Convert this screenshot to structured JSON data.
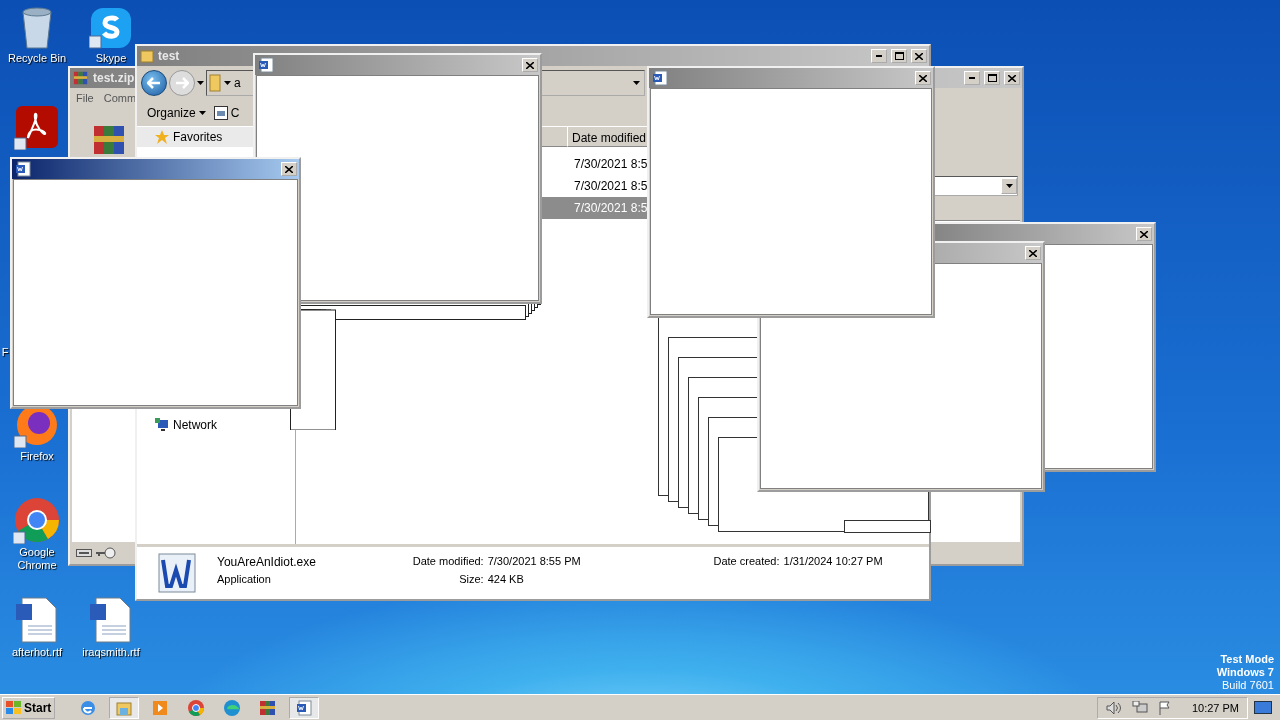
{
  "desktop_icons": [
    {
      "kind": "recycle",
      "label": "Recycle Bin"
    },
    {
      "kind": "skype",
      "label": "Skype"
    },
    {
      "kind": "acrobat"
    },
    {
      "kind": "hidden",
      "label": "F"
    },
    {
      "kind": "firefox",
      "label": "Firefox"
    },
    {
      "kind": "chrome",
      "label": "Google Chrome"
    },
    {
      "kind": "document",
      "label": "afterhot.rtf"
    },
    {
      "kind": "document",
      "label": "iraqsmith.rtf"
    }
  ],
  "winrar_window": {
    "title": "test.zip",
    "menu": [
      "File",
      "Comm"
    ]
  },
  "explorer_window": {
    "title": "test",
    "address": "a",
    "toolbar": [
      "Organize",
      "C"
    ],
    "nav": [
      "Favorites",
      "Network"
    ],
    "columns": [
      "Date modified"
    ],
    "rows": [
      {
        "date": "7/30/2021 8:5",
        "selected": false
      },
      {
        "date": "7/30/2021 8:5",
        "selected": false
      },
      {
        "date": "7/30/2021 8:5",
        "selected": true
      }
    ],
    "details": {
      "name": "YouAreAnIdiot.exe",
      "type": "Application",
      "fields": [
        {
          "label": "Date modified:",
          "value": "7/30/2021 8:55 PM"
        },
        {
          "label": "Size:",
          "value": "424 KB"
        },
        {
          "label": "Date created:",
          "value": "1/31/2024 10:27 PM"
        }
      ]
    }
  },
  "popups": [
    {
      "active": false
    },
    {
      "active": false
    },
    {
      "active": false
    },
    {
      "active": false
    },
    {
      "active": true
    }
  ],
  "taskbar": {
    "start": "Start",
    "buttons": [
      {
        "kind": "ie",
        "pressed": false
      },
      {
        "kind": "explorer",
        "pressed": true
      },
      {
        "kind": "media",
        "pressed": false
      },
      {
        "kind": "chrome",
        "pressed": false
      },
      {
        "kind": "edge",
        "pressed": false
      },
      {
        "kind": "winrar",
        "pressed": false
      },
      {
        "kind": "word",
        "pressed": true
      }
    ],
    "clock": "10:27 PM"
  },
  "os_notice": [
    "Test Mode",
    "Windows 7",
    "Build 7601"
  ]
}
